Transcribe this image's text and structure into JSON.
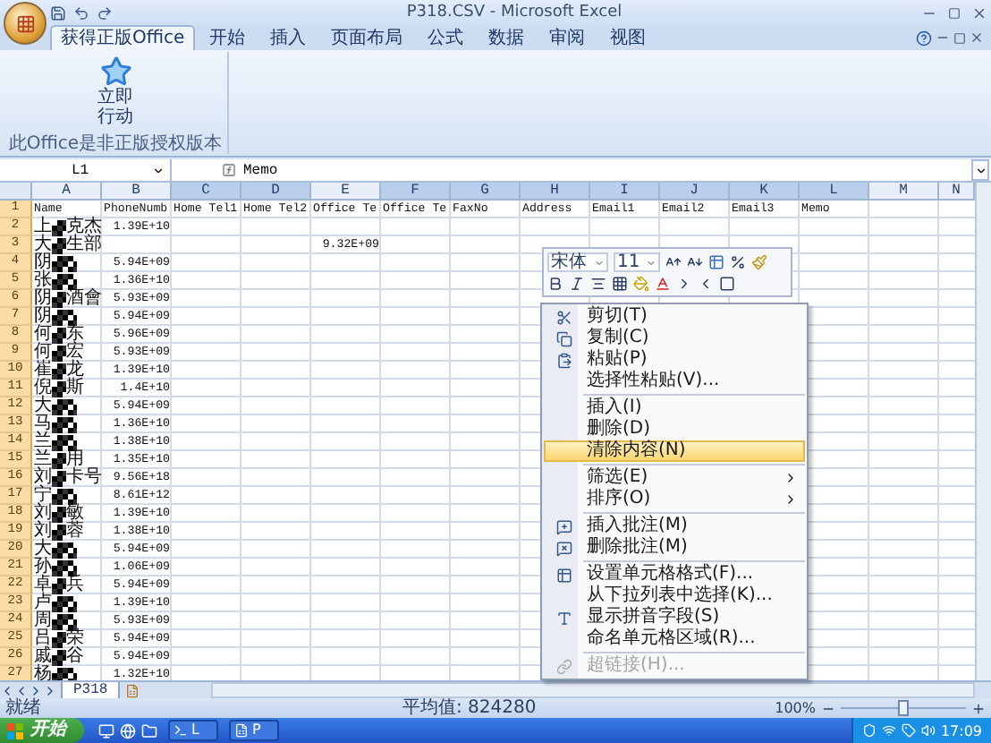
{
  "window": {
    "title": "P318.CSV - Microsoft Excel"
  },
  "tabs": [
    {
      "label": "获得正版Office",
      "selected": true
    },
    {
      "label": "开始",
      "selected": false
    },
    {
      "label": "插入",
      "selected": false
    },
    {
      "label": "页面布局",
      "selected": false
    },
    {
      "label": "公式",
      "selected": false
    },
    {
      "label": "数据",
      "selected": false
    },
    {
      "label": "审阅",
      "selected": false
    },
    {
      "label": "视图",
      "selected": false
    }
  ],
  "ribbon": {
    "button_lines": [
      "立即",
      "行动"
    ],
    "group_label": "此Office是非正版授权版本"
  },
  "formula_bar": {
    "name_box": "L1",
    "value": "Memo"
  },
  "columns": [
    {
      "label": "A",
      "selected": false
    },
    {
      "label": "B",
      "selected": false
    },
    {
      "label": "C",
      "selected": true
    },
    {
      "label": "D",
      "selected": true
    },
    {
      "label": "E",
      "selected": false
    },
    {
      "label": "F",
      "selected": true
    },
    {
      "label": "G",
      "selected": true
    },
    {
      "label": "H",
      "selected": true
    },
    {
      "label": "I",
      "selected": true
    },
    {
      "label": "J",
      "selected": true
    },
    {
      "label": "K",
      "selected": true
    },
    {
      "label": "L",
      "selected": true
    },
    {
      "label": "M",
      "selected": false
    },
    {
      "label": "N",
      "selected": false
    }
  ],
  "header_row": {
    "number": "1",
    "cells": [
      "Name",
      "PhoneNumb",
      "Home Tel1",
      "Home Tel2",
      "Office Te",
      "Office Te",
      "FaxNo",
      "Address",
      "Email1",
      "Email2",
      "Email3",
      "Memo"
    ]
  },
  "rows": [
    {
      "number": "2",
      "name_parts": [
        "上",
        "克杰"
      ],
      "phone": "1.39E+10"
    },
    {
      "number": "3",
      "name_parts": [
        "大",
        "生部"
      ],
      "office_tel": "9.32E+09"
    },
    {
      "number": "4",
      "name_parts": [
        "阴"
      ],
      "phone": "5.94E+09"
    },
    {
      "number": "5",
      "name_parts": [
        "张"
      ],
      "phone": "1.36E+10"
    },
    {
      "number": "6",
      "name_parts": [
        "阴",
        "酒會"
      ],
      "phone": "5.93E+09"
    },
    {
      "number": "7",
      "name_parts": [
        "阴"
      ],
      "phone": "5.94E+09"
    },
    {
      "number": "8",
      "name_parts": [
        "何",
        "东"
      ],
      "phone": "5.96E+09"
    },
    {
      "number": "9",
      "name_parts": [
        "何",
        "宏"
      ],
      "phone": "5.93E+09"
    },
    {
      "number": "10",
      "name_parts": [
        "崔",
        "龙"
      ],
      "phone": "1.39E+10"
    },
    {
      "number": "11",
      "name_parts": [
        "倪",
        "斯"
      ],
      "phone": "1.4E+10"
    },
    {
      "number": "12",
      "name_parts": [
        "大"
      ],
      "phone": "5.94E+09"
    },
    {
      "number": "13",
      "name_parts": [
        "马"
      ],
      "phone": "1.36E+10"
    },
    {
      "number": "14",
      "name_parts": [
        "兰"
      ],
      "phone": "1.38E+10"
    },
    {
      "number": "15",
      "name_parts": [
        "兰",
        "用"
      ],
      "phone": "1.35E+10"
    },
    {
      "number": "16",
      "name_parts": [
        "刘",
        "卡号"
      ],
      "phone": "9.56E+18"
    },
    {
      "number": "17",
      "name_parts": [
        "宁"
      ],
      "phone": "8.61E+12"
    },
    {
      "number": "18",
      "name_parts": [
        "刘",
        "敏"
      ],
      "phone": "1.39E+10"
    },
    {
      "number": "19",
      "name_parts": [
        "刘",
        "蓉"
      ],
      "phone": "1.38E+10"
    },
    {
      "number": "20",
      "name_parts": [
        "大"
      ],
      "phone": "5.94E+09"
    },
    {
      "number": "21",
      "name_parts": [
        "孙"
      ],
      "phone": "1.06E+09"
    },
    {
      "number": "22",
      "name_parts": [
        "卓",
        "兵"
      ],
      "phone": "5.94E+09"
    },
    {
      "number": "23",
      "name_parts": [
        "卢"
      ],
      "phone": "1.39E+10"
    },
    {
      "number": "24",
      "name_parts": [
        "周"
      ],
      "phone": "5.93E+09"
    },
    {
      "number": "25",
      "name_parts": [
        "吕",
        "荣"
      ],
      "phone": "5.94E+09"
    },
    {
      "number": "26",
      "name_parts": [
        "戚",
        "谷"
      ],
      "phone": "5.94E+09"
    },
    {
      "number": "27",
      "name_parts": [
        "杨"
      ],
      "phone": "1.32E+10"
    }
  ],
  "sheet_tabs": [
    {
      "label": "P318",
      "selected": true
    }
  ],
  "status_bar": {
    "state": "就绪",
    "average": "平均值: 824280",
    "zoom": "100%",
    "zoom_slider": {
      "level": 0.5
    }
  },
  "mini_toolbar": {
    "font": "宋体",
    "size": "11"
  },
  "context_menu": {
    "items": [
      {
        "kind": "item",
        "label": "剪切(T)",
        "selected": false,
        "disabled": false
      },
      {
        "kind": "item",
        "label": "复制(C)",
        "selected": false,
        "disabled": false
      },
      {
        "kind": "item",
        "label": "粘贴(P)",
        "selected": false,
        "disabled": false
      },
      {
        "kind": "item",
        "label": "选择性粘贴(V)...",
        "selected": false,
        "disabled": false
      },
      {
        "kind": "separator"
      },
      {
        "kind": "item",
        "label": "插入(I)",
        "selected": false,
        "disabled": false
      },
      {
        "kind": "item",
        "label": "删除(D)",
        "selected": false,
        "disabled": false
      },
      {
        "kind": "item",
        "label": "清除内容(N)",
        "selected": true,
        "disabled": false
      },
      {
        "kind": "separator"
      },
      {
        "kind": "submenu",
        "label": "筛选(E)",
        "selected": false,
        "disabled": false
      },
      {
        "kind": "submenu",
        "label": "排序(O)",
        "selected": false,
        "disabled": false
      },
      {
        "kind": "separator"
      },
      {
        "kind": "item",
        "label": "插入批注(M)",
        "selected": false,
        "disabled": false
      },
      {
        "kind": "item",
        "label": "删除批注(M)",
        "selected": false,
        "disabled": false
      },
      {
        "kind": "separator"
      },
      {
        "kind": "item",
        "label": "设置单元格格式(F)...",
        "selected": false,
        "disabled": false
      },
      {
        "kind": "item",
        "label": "从下拉列表中选择(K)...",
        "selected": false,
        "disabled": false
      },
      {
        "kind": "item",
        "label": "显示拼音字段(S)",
        "selected": false,
        "disabled": false
      },
      {
        "kind": "item",
        "label": "命名单元格区域(R)...",
        "selected": false,
        "disabled": false
      },
      {
        "kind": "separator"
      },
      {
        "kind": "item",
        "label": "超链接(H)...",
        "selected": false,
        "disabled": true
      }
    ]
  },
  "taskbar": {
    "start": "开始",
    "tasks": [
      {
        "label": "L"
      },
      {
        "label": "P"
      }
    ],
    "clock": "17:09"
  }
}
